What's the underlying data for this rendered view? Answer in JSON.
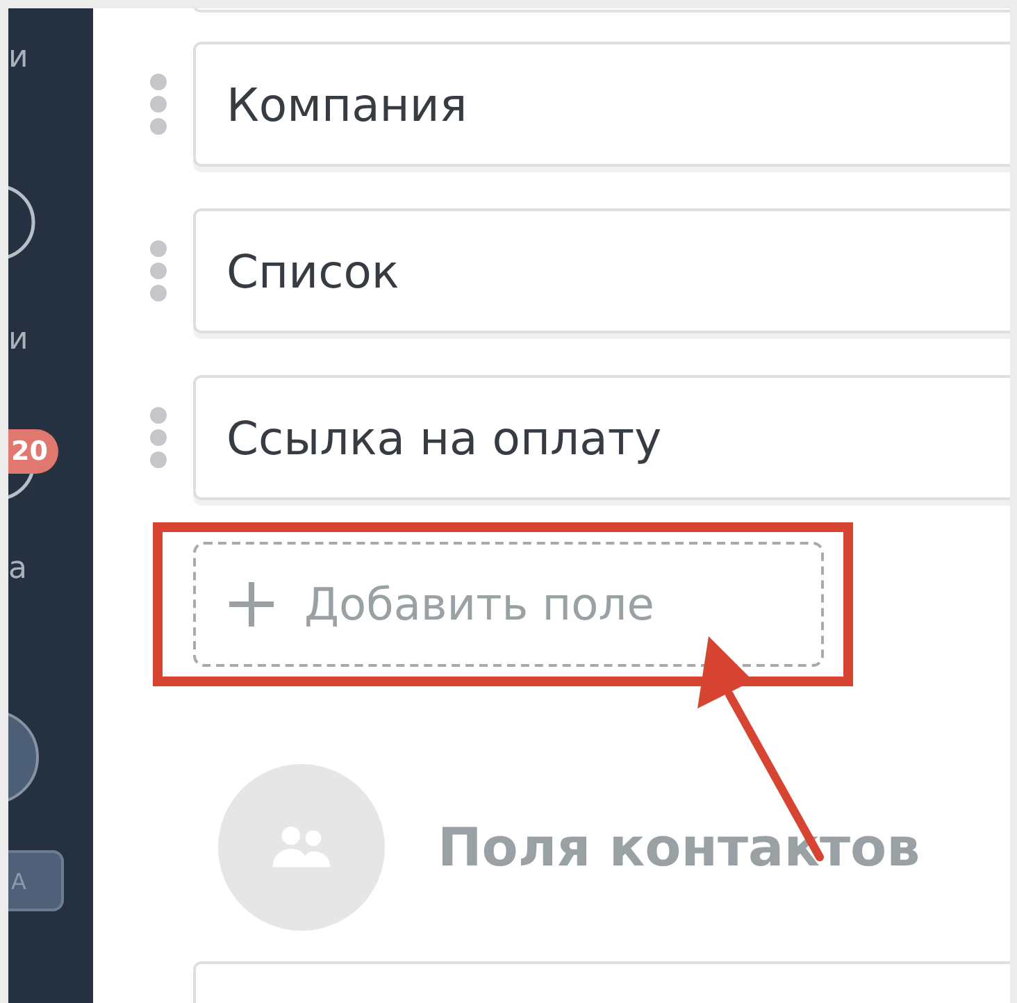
{
  "sidebar": {
    "items": [
      {
        "kind": "label",
        "text": "и"
      },
      {
        "kind": "icon"
      },
      {
        "kind": "label",
        "text": "и"
      },
      {
        "kind": "badge",
        "text": "20"
      },
      {
        "kind": "icon-edge"
      },
      {
        "kind": "label",
        "text": "а"
      },
      {
        "kind": "avatar"
      },
      {
        "kind": "button",
        "text": "А"
      }
    ]
  },
  "fields": [
    {
      "value": "Компания"
    },
    {
      "value": "Список"
    },
    {
      "value": "Ссылка на оплату"
    }
  ],
  "add_field": {
    "label": "Добавить поле"
  },
  "contacts_section": {
    "title": "Поля контактов"
  }
}
